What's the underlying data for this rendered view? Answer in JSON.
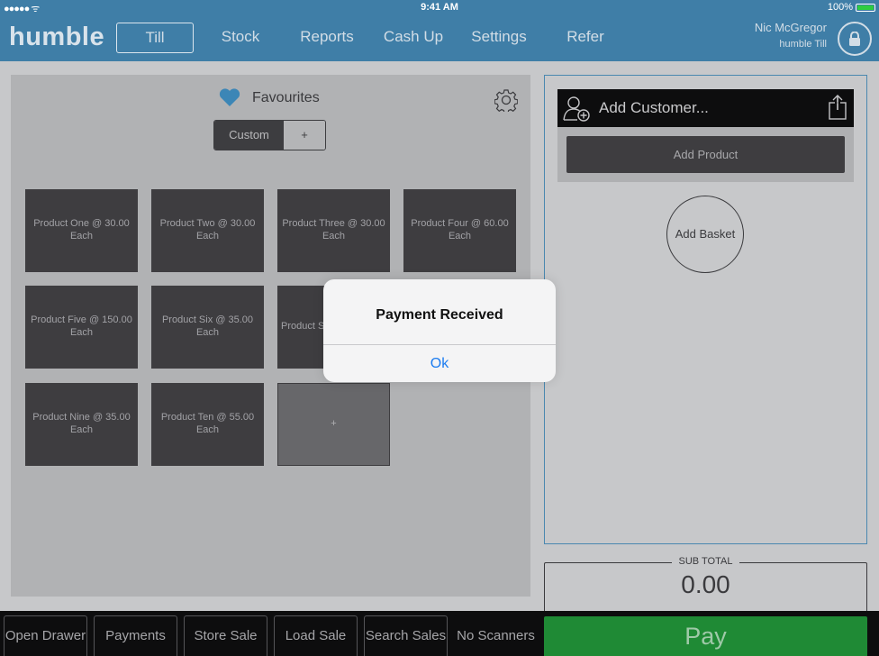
{
  "status_bar": {
    "signal": "●●●●● ᯤ",
    "time": "9:41 AM",
    "battery": "100%"
  },
  "header": {
    "logo": "humble",
    "tabs": [
      "Till",
      "Stock",
      "Reports",
      "Cash Up",
      "Settings",
      "Refer"
    ],
    "active_tab": "Till",
    "user_name": "Nic McGregor",
    "user_sub": "humble Till"
  },
  "favourites": {
    "title": "Favourites",
    "segment_custom": "Custom",
    "segment_add": "+",
    "products": [
      "Product One @ 30.00 Each",
      "Product Two @ 30.00 Each",
      "Product Three @ 30.00 Each",
      "Product Four @ 60.00 Each",
      "Product Five @ 150.00 Each",
      "Product Six @ 35.00 Each",
      "Product S",
      "Product Nine @ 35.00 Each",
      "Product Ten @ 55.00 Each"
    ],
    "add_tile": "+"
  },
  "basket": {
    "add_customer": "Add Customer...",
    "add_product": "Add Product",
    "add_basket": "Add Basket",
    "subtotal_label": "SUB TOTAL",
    "subtotal_value": "0.00"
  },
  "bottom_bar": {
    "open_drawer": "Open Drawer",
    "payments": "Payments",
    "store_sale": "Store Sale",
    "load_sale": "Load Sale",
    "search_sales": "Search Sales",
    "no_scanners": "No Scanners",
    "pay": "Pay"
  },
  "alert": {
    "title": "Payment Received",
    "ok": "Ok"
  },
  "colors": {
    "nav_blue": "#3f7ea7",
    "pay_green": "#1f8a35",
    "alert_link": "#1b7cf0"
  }
}
